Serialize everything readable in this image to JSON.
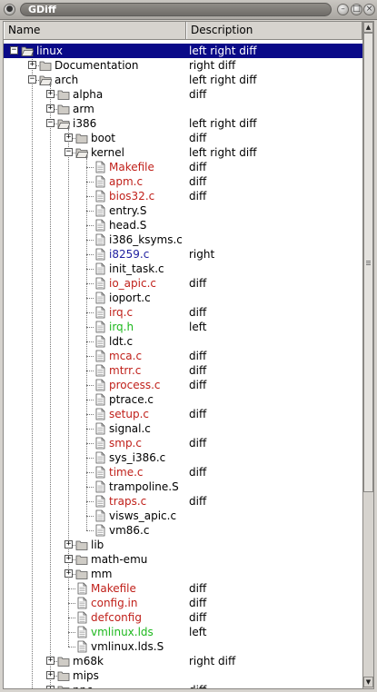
{
  "window": {
    "title": "GDiff"
  },
  "columns": {
    "name": "Name",
    "description": "Description"
  },
  "colors": {
    "selected_bg": "#0a0a88",
    "removed": "#c0201a",
    "added": "#1db81d",
    "right_only": "#2020a0",
    "plain": "#000000"
  },
  "rows": [
    {
      "name": "linux",
      "desc": "left right diff",
      "depth": 0,
      "kind": "folder-open",
      "exp": "minus",
      "color": "#ffffff",
      "selected": true
    },
    {
      "name": "Documentation",
      "desc": "right diff",
      "depth": 1,
      "kind": "folder",
      "exp": "plus",
      "color": "#000000"
    },
    {
      "name": "arch",
      "desc": "left right diff",
      "depth": 1,
      "kind": "folder-open",
      "exp": "minus",
      "color": "#000000"
    },
    {
      "name": "alpha",
      "desc": "diff",
      "depth": 2,
      "kind": "folder",
      "exp": "plus",
      "color": "#000000"
    },
    {
      "name": "arm",
      "desc": "",
      "depth": 2,
      "kind": "folder",
      "exp": "plus",
      "color": "#000000"
    },
    {
      "name": "i386",
      "desc": "left right diff",
      "depth": 2,
      "kind": "folder-open",
      "exp": "minus",
      "color": "#000000"
    },
    {
      "name": "boot",
      "desc": "diff",
      "depth": 3,
      "kind": "folder",
      "exp": "plus",
      "color": "#000000"
    },
    {
      "name": "kernel",
      "desc": "left right diff",
      "depth": 3,
      "kind": "folder-open",
      "exp": "minus",
      "color": "#000000"
    },
    {
      "name": "Makefile",
      "desc": "diff",
      "depth": 4,
      "kind": "file",
      "color": "#c0201a"
    },
    {
      "name": "apm.c",
      "desc": "diff",
      "depth": 4,
      "kind": "file",
      "color": "#c0201a"
    },
    {
      "name": "bios32.c",
      "desc": "diff",
      "depth": 4,
      "kind": "file",
      "color": "#c0201a"
    },
    {
      "name": "entry.S",
      "desc": "",
      "depth": 4,
      "kind": "file",
      "color": "#000000"
    },
    {
      "name": "head.S",
      "desc": "",
      "depth": 4,
      "kind": "file",
      "color": "#000000"
    },
    {
      "name": "i386_ksyms.c",
      "desc": "",
      "depth": 4,
      "kind": "file",
      "color": "#000000"
    },
    {
      "name": "i8259.c",
      "desc": "right",
      "depth": 4,
      "kind": "file",
      "color": "#2020a0"
    },
    {
      "name": "init_task.c",
      "desc": "",
      "depth": 4,
      "kind": "file",
      "color": "#000000"
    },
    {
      "name": "io_apic.c",
      "desc": "diff",
      "depth": 4,
      "kind": "file",
      "color": "#c0201a"
    },
    {
      "name": "ioport.c",
      "desc": "",
      "depth": 4,
      "kind": "file",
      "color": "#000000"
    },
    {
      "name": "irq.c",
      "desc": "diff",
      "depth": 4,
      "kind": "file",
      "color": "#c0201a"
    },
    {
      "name": "irq.h",
      "desc": "left",
      "depth": 4,
      "kind": "file",
      "color": "#1db81d"
    },
    {
      "name": "ldt.c",
      "desc": "",
      "depth": 4,
      "kind": "file",
      "color": "#000000"
    },
    {
      "name": "mca.c",
      "desc": "diff",
      "depth": 4,
      "kind": "file",
      "color": "#c0201a"
    },
    {
      "name": "mtrr.c",
      "desc": "diff",
      "depth": 4,
      "kind": "file",
      "color": "#c0201a"
    },
    {
      "name": "process.c",
      "desc": "diff",
      "depth": 4,
      "kind": "file",
      "color": "#c0201a"
    },
    {
      "name": "ptrace.c",
      "desc": "",
      "depth": 4,
      "kind": "file",
      "color": "#000000"
    },
    {
      "name": "setup.c",
      "desc": "diff",
      "depth": 4,
      "kind": "file",
      "color": "#c0201a"
    },
    {
      "name": "signal.c",
      "desc": "",
      "depth": 4,
      "kind": "file",
      "color": "#000000"
    },
    {
      "name": "smp.c",
      "desc": "diff",
      "depth": 4,
      "kind": "file",
      "color": "#c0201a"
    },
    {
      "name": "sys_i386.c",
      "desc": "",
      "depth": 4,
      "kind": "file",
      "color": "#000000"
    },
    {
      "name": "time.c",
      "desc": "diff",
      "depth": 4,
      "kind": "file",
      "color": "#c0201a"
    },
    {
      "name": "trampoline.S",
      "desc": "",
      "depth": 4,
      "kind": "file",
      "color": "#000000"
    },
    {
      "name": "traps.c",
      "desc": "diff",
      "depth": 4,
      "kind": "file",
      "color": "#c0201a"
    },
    {
      "name": "visws_apic.c",
      "desc": "",
      "depth": 4,
      "kind": "file",
      "color": "#000000"
    },
    {
      "name": "vm86.c",
      "desc": "",
      "depth": 4,
      "kind": "file",
      "color": "#000000",
      "last": true
    },
    {
      "name": "lib",
      "desc": "",
      "depth": 3,
      "kind": "folder",
      "exp": "plus",
      "color": "#000000"
    },
    {
      "name": "math-emu",
      "desc": "",
      "depth": 3,
      "kind": "folder",
      "exp": "plus",
      "color": "#000000"
    },
    {
      "name": "mm",
      "desc": "",
      "depth": 3,
      "kind": "folder",
      "exp": "plus",
      "color": "#000000"
    },
    {
      "name": "Makefile",
      "desc": "diff",
      "depth": 3,
      "kind": "file",
      "color": "#c0201a"
    },
    {
      "name": "config.in",
      "desc": "diff",
      "depth": 3,
      "kind": "file",
      "color": "#c0201a"
    },
    {
      "name": "defconfig",
      "desc": "diff",
      "depth": 3,
      "kind": "file",
      "color": "#c0201a"
    },
    {
      "name": "vmlinux.lds",
      "desc": "left",
      "depth": 3,
      "kind": "file",
      "color": "#1db81d"
    },
    {
      "name": "vmlinux.lds.S",
      "desc": "",
      "depth": 3,
      "kind": "file",
      "color": "#000000",
      "last": true
    },
    {
      "name": "m68k",
      "desc": "right diff",
      "depth": 2,
      "kind": "folder",
      "exp": "plus",
      "color": "#000000"
    },
    {
      "name": "mips",
      "desc": "",
      "depth": 2,
      "kind": "folder",
      "exp": "plus",
      "color": "#000000"
    },
    {
      "name": "ppc",
      "desc": "diff",
      "depth": 2,
      "kind": "folder",
      "exp": "plus",
      "color": "#000000"
    }
  ],
  "icons": {
    "folder": "folder-icon",
    "folder-open": "folder-open-icon",
    "file": "file-icon",
    "plus": "expand-icon",
    "minus": "collapse-icon"
  }
}
